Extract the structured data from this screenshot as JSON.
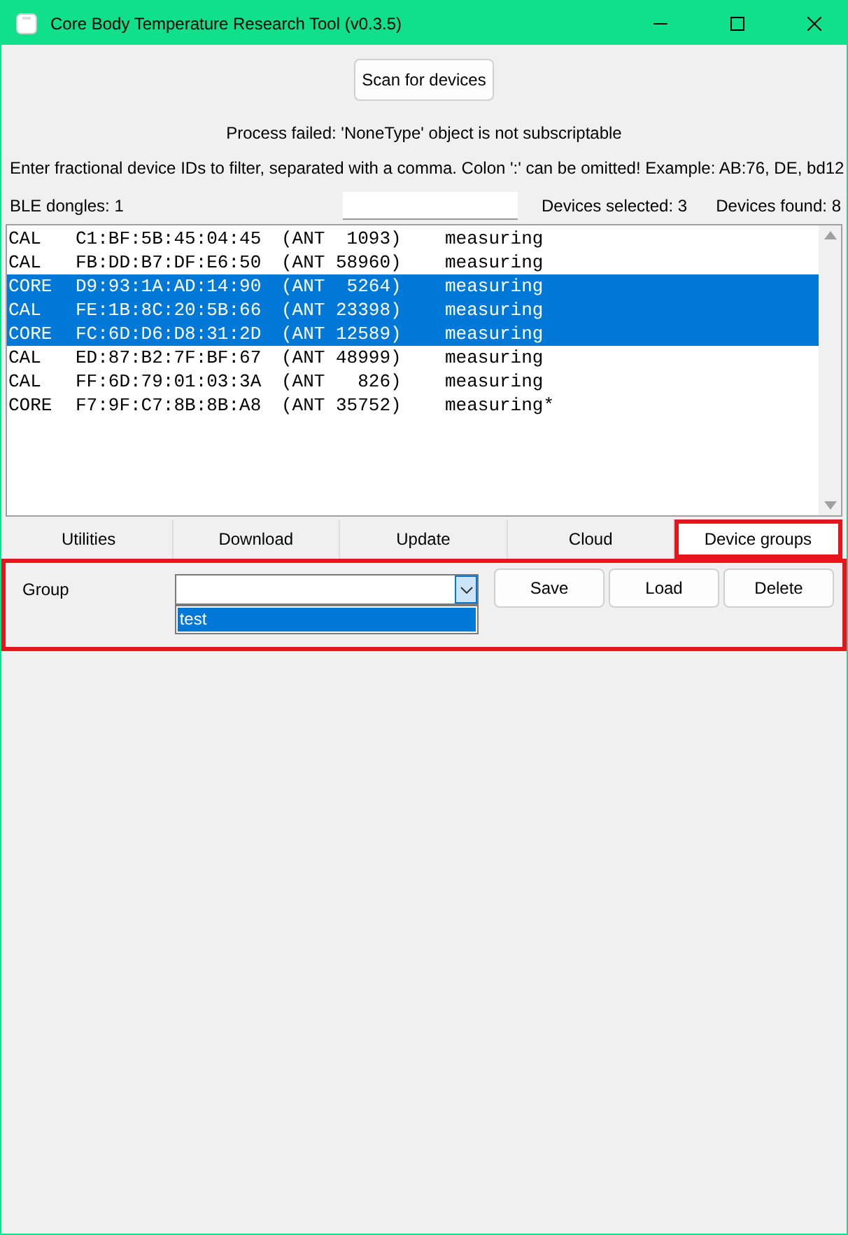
{
  "window": {
    "title": "Core Body Temperature Research Tool (v0.3.5)"
  },
  "scan_button": "Scan for devices",
  "status_message": "Process failed: 'NoneType' object is not subscriptable",
  "filter_hint": "Enter fractional device IDs to filter, separated with a comma. Colon ':' can be omitted! Example: AB:76, DE, bd12",
  "ble_dongles": "BLE dongles: 1",
  "devices_selected": "Devices selected: 3",
  "devices_found": "Devices found: 8",
  "devices": [
    {
      "type": "CAL",
      "address": "C1:BF:5B:45:04:45",
      "ant": "(ANT  1093)",
      "status": "measuring",
      "selected": false
    },
    {
      "type": "CAL",
      "address": "FB:DD:B7:DF:E6:50",
      "ant": "(ANT 58960)",
      "status": "measuring",
      "selected": false
    },
    {
      "type": "CORE",
      "address": "D9:93:1A:AD:14:90",
      "ant": "(ANT  5264)",
      "status": "measuring",
      "selected": true
    },
    {
      "type": "CAL",
      "address": "FE:1B:8C:20:5B:66",
      "ant": "(ANT 23398)",
      "status": "measuring",
      "selected": true
    },
    {
      "type": "CORE",
      "address": "FC:6D:D6:D8:31:2D",
      "ant": "(ANT 12589)",
      "status": "measuring",
      "selected": true
    },
    {
      "type": "CAL",
      "address": "ED:87:B2:7F:BF:67",
      "ant": "(ANT 48999)",
      "status": "measuring",
      "selected": false
    },
    {
      "type": "CAL",
      "address": "FF:6D:79:01:03:3A",
      "ant": "(ANT   826)",
      "status": "measuring",
      "selected": false
    },
    {
      "type": "CORE",
      "address": "F7:9F:C7:8B:8B:A8",
      "ant": "(ANT 35752)",
      "status": "measuring*",
      "selected": false
    }
  ],
  "tabs": [
    {
      "label": "Utilities",
      "selected": false
    },
    {
      "label": "Download",
      "selected": false
    },
    {
      "label": "Update",
      "selected": false
    },
    {
      "label": "Cloud",
      "selected": false
    },
    {
      "label": "Device groups",
      "selected": true
    }
  ],
  "device_groups": {
    "highlighted": true,
    "group_label": "Group",
    "dropdown": {
      "expanded": true,
      "options": [
        {
          "label": "test",
          "selected": true
        }
      ]
    },
    "buttons": [
      "Save",
      "Load",
      "Delete"
    ]
  }
}
